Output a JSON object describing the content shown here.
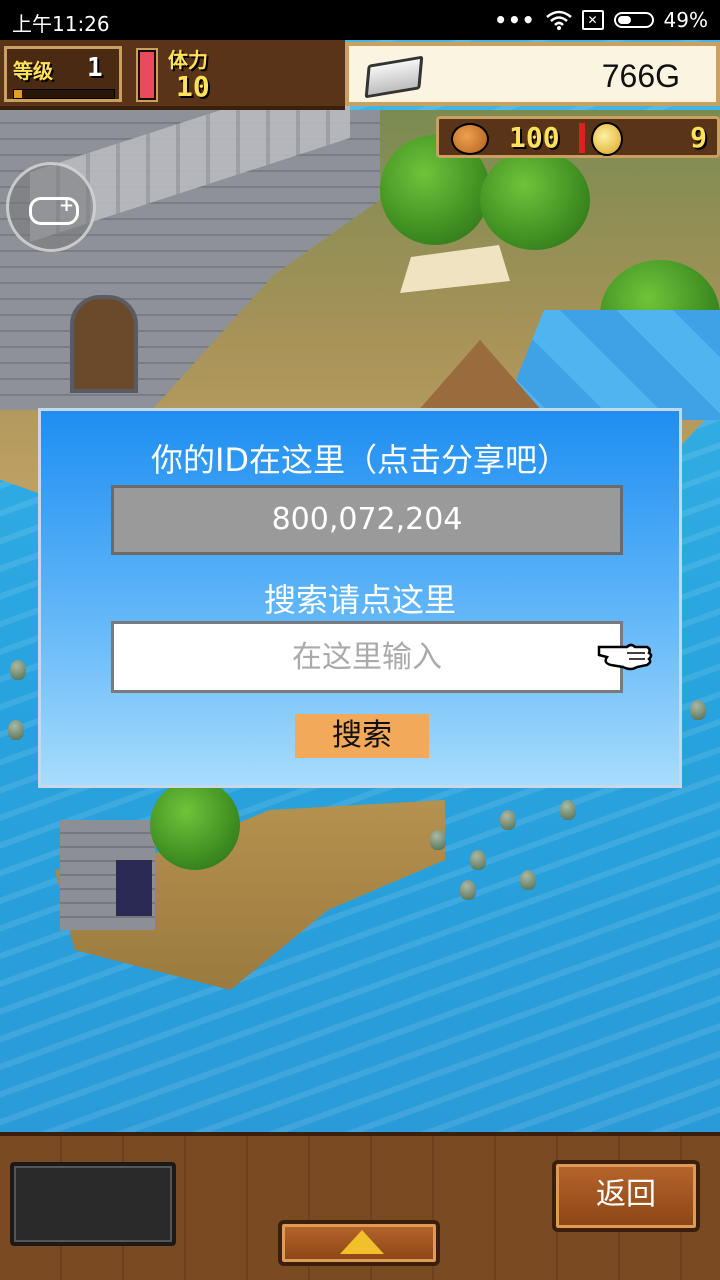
{
  "status_bar": {
    "time": "上午11:26",
    "dots": "•••",
    "sim": "✕",
    "battery_percent": "49%",
    "battery_level": 0.49
  },
  "hud": {
    "level_label": "等级",
    "level_value": "1",
    "stamina_label": "体力",
    "stamina_value": "10",
    "gold_value": "766G",
    "food_value": "100",
    "medal_value": "9"
  },
  "dialog": {
    "title": "你的ID在这里（点击分享吧）",
    "id_value": "800,072,204",
    "search_label": "搜索请点这里",
    "search_placeholder": "在这里输入",
    "search_button": "搜索"
  },
  "bottom_bar": {
    "back_button": "返回"
  },
  "icons": [
    "wifi-icon",
    "sim-icon",
    "battery-icon",
    "silver-bar-icon",
    "food-icon",
    "coin-icon",
    "gamepad-icon",
    "pointing-hand-icon",
    "up-arrow-icon"
  ],
  "colors": {
    "dialog_top": "#1e8ef2",
    "dialog_bottom": "#a7dcfc",
    "search_button": "#f2a95a",
    "hud_text": "#ffe15a",
    "hud_wood": "#5a3418"
  }
}
